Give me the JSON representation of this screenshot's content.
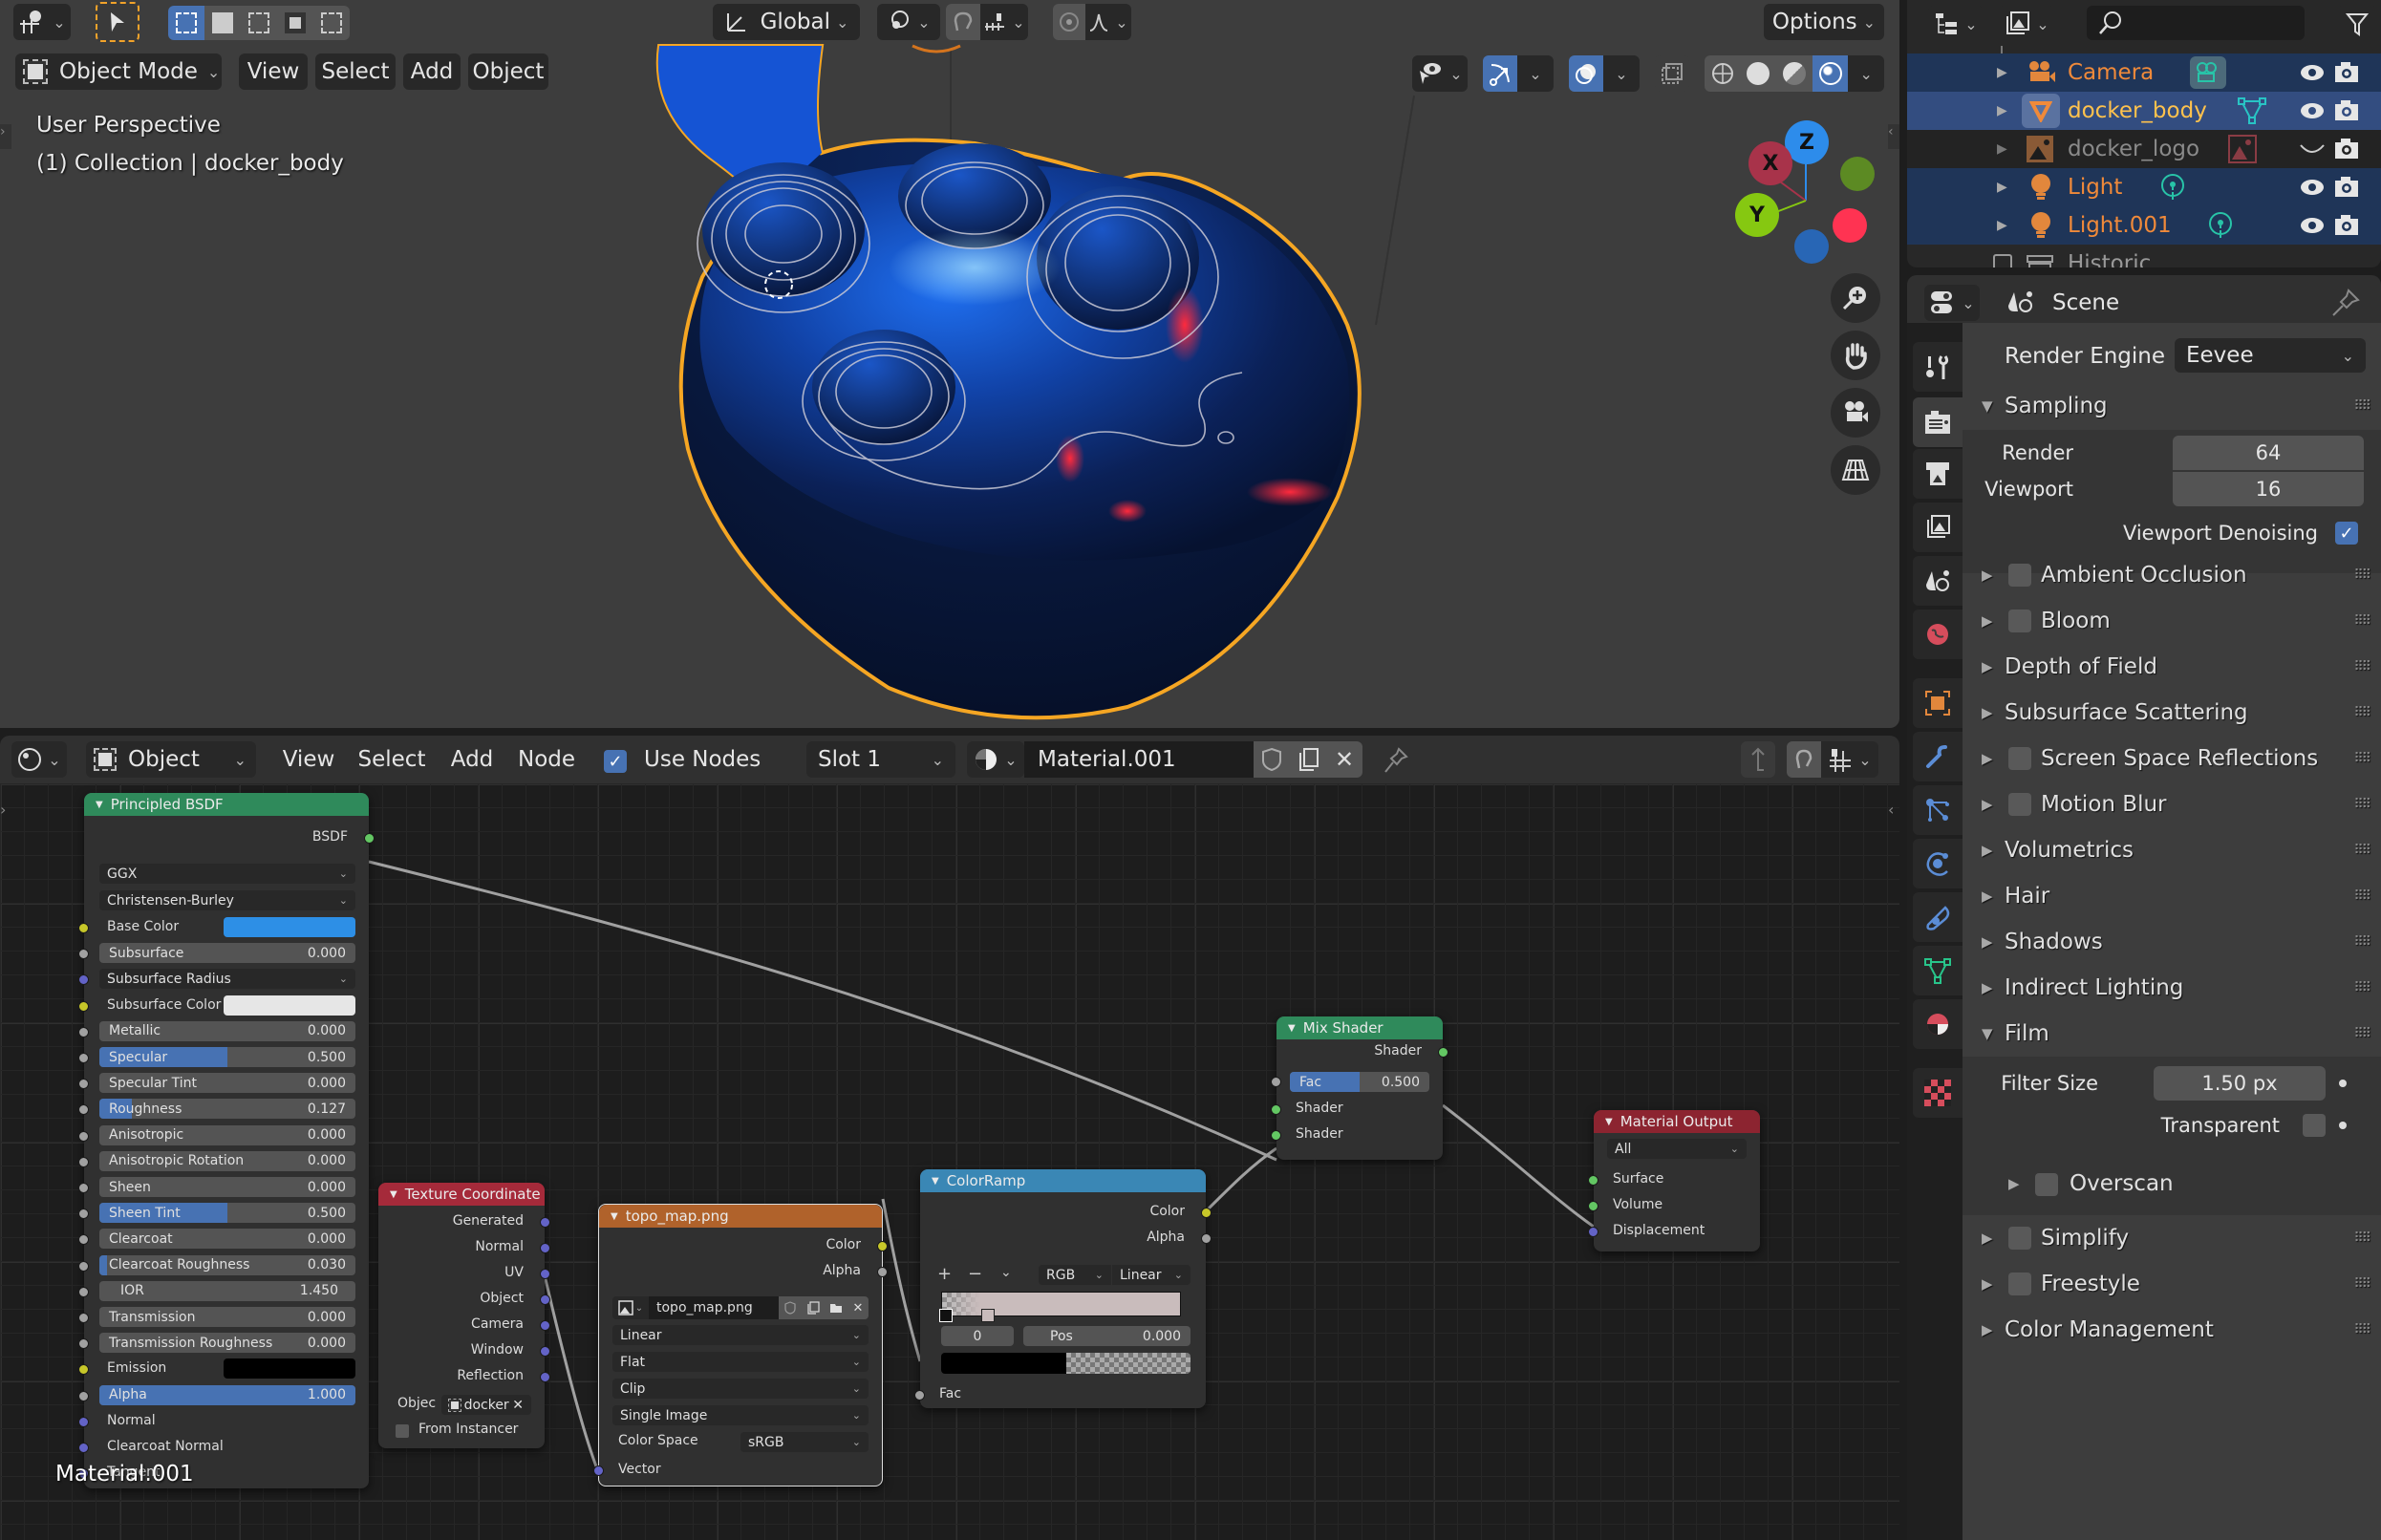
{
  "viewport": {
    "header": {
      "transform_orientation": "Global",
      "options_label": "Options",
      "mode_label": "Object Mode",
      "menus": [
        "View",
        "Select",
        "Add",
        "Object"
      ]
    },
    "overlay": {
      "view_name": "User Perspective",
      "collection_info": "(1) Collection | docker_body"
    },
    "gizmo": {
      "x": "X",
      "y": "Y",
      "z": "Z"
    },
    "colors": {
      "selection_outline": "#f5a623",
      "x_axis": "#a8334a",
      "y_axis": "#86c811",
      "z_axis": "#2d8ceb"
    }
  },
  "outliner": {
    "search_placeholder": "",
    "items": [
      {
        "name": "Camera",
        "type": "camera",
        "state": "partial"
      },
      {
        "name": "docker_body",
        "type": "mesh",
        "state": "active"
      },
      {
        "name": "docker_logo",
        "type": "image",
        "state": "hidden"
      },
      {
        "name": "Light",
        "type": "light",
        "state": "partial"
      },
      {
        "name": "Light.001",
        "type": "light",
        "state": "partial"
      }
    ],
    "partial_item": "Historic"
  },
  "properties": {
    "context_label": "Scene",
    "render_engine_label": "Render Engine",
    "render_engine_value": "Eevee",
    "sampling": {
      "title": "Sampling",
      "render_label": "Render",
      "render_value": "64",
      "viewport_label": "Viewport",
      "viewport_value": "16",
      "denoise_label": "Viewport Denoising",
      "denoise_checked": true
    },
    "panels": [
      {
        "label": "Ambient Occlusion",
        "checkbox": true,
        "checked": false
      },
      {
        "label": "Bloom",
        "checkbox": true,
        "checked": false
      },
      {
        "label": "Depth of Field",
        "checkbox": false
      },
      {
        "label": "Subsurface Scattering",
        "checkbox": false
      },
      {
        "label": "Screen Space Reflections",
        "checkbox": true,
        "checked": false
      },
      {
        "label": "Motion Blur",
        "checkbox": true,
        "checked": false
      },
      {
        "label": "Volumetrics",
        "checkbox": false
      },
      {
        "label": "Hair",
        "checkbox": false
      },
      {
        "label": "Shadows",
        "checkbox": false
      },
      {
        "label": "Indirect Lighting",
        "checkbox": false
      }
    ],
    "film": {
      "title": "Film",
      "filter_size_label": "Filter Size",
      "filter_size_value": "1.50 px",
      "transparent_label": "Transparent",
      "transparent_checked": false,
      "overscan_label": "Overscan"
    },
    "panels_after": [
      {
        "label": "Simplify",
        "checkbox": true,
        "checked": false
      },
      {
        "label": "Freestyle",
        "checkbox": true,
        "checked": false
      },
      {
        "label": "Color Management",
        "checkbox": false
      }
    ]
  },
  "node_editor": {
    "header": {
      "object_label": "Object",
      "menus": [
        "View",
        "Select",
        "Add",
        "Node"
      ],
      "use_nodes_label": "Use Nodes",
      "use_nodes_checked": true,
      "slot_label": "Slot 1",
      "material_name": "Material.001"
    },
    "material_label": "Material.001",
    "principled": {
      "title": "Principled BSDF",
      "output": "BSDF",
      "distribution": "GGX",
      "subsurface_method": "Christensen-Burley",
      "base_color_label": "Base Color",
      "base_color": "#2d8fe6",
      "subsurface_label": "Subsurface",
      "subsurface": "0.000",
      "subsurface_radius_label": "Subsurface Radius",
      "subsurface_color_label": "Subsurface Color",
      "subsurface_color": "#e6e6e6",
      "metallic_label": "Metallic",
      "metallic": "0.000",
      "specular_label": "Specular",
      "specular": "0.500",
      "specular_frac": 0.5,
      "specular_tint_label": "Specular Tint",
      "specular_tint": "0.000",
      "roughness_label": "Roughness",
      "roughness": "0.127",
      "roughness_frac": 0.127,
      "anisotropic_label": "Anisotropic",
      "anisotropic": "0.000",
      "anisotropic_rotation_label": "Anisotropic Rotation",
      "anisotropic_rotation": "0.000",
      "sheen_label": "Sheen",
      "sheen": "0.000",
      "sheen_tint_label": "Sheen Tint",
      "sheen_tint": "0.500",
      "sheen_tint_frac": 0.5,
      "clearcoat_label": "Clearcoat",
      "clearcoat": "0.000",
      "clearcoat_roughness_label": "Clearcoat Roughness",
      "clearcoat_roughness": "0.030",
      "clearcoat_roughness_frac": 0.03,
      "ior_label": "IOR",
      "ior": "1.450",
      "transmission_label": "Transmission",
      "transmission": "0.000",
      "transmission_roughness_label": "Transmission Roughness",
      "transmission_roughness": "0.000",
      "emission_label": "Emission",
      "emission_color": "#000000",
      "alpha_label": "Alpha",
      "alpha": "1.000",
      "alpha_frac": 1.0,
      "normal_label": "Normal",
      "clearcoat_normal_label": "Clearcoat Normal",
      "tangent_label": "Tangent"
    },
    "texcoord": {
      "title": "Texture Coordinate",
      "outputs": [
        "Generated",
        "Normal",
        "UV",
        "Object",
        "Camera",
        "Window",
        "Reflection"
      ],
      "object_label": "Objec",
      "object_value": "docker",
      "from_instancer_label": "From Instancer"
    },
    "image_tex": {
      "title": "topo_map.png",
      "out_color": "Color",
      "out_alpha": "Alpha",
      "image_name": "topo_map.png",
      "interpolation": "Linear",
      "projection": "Flat",
      "extension": "Clip",
      "source": "Single Image",
      "color_space_label": "Color Space",
      "color_space": "sRGB",
      "input_vector": "Vector"
    },
    "colorramp": {
      "title": "ColorRamp",
      "out_color": "Color",
      "out_alpha": "Alpha",
      "color_mode": "RGB",
      "interpolation": "Linear",
      "active_index": "0",
      "pos_label": "Pos",
      "pos_value": "0.000",
      "input_fac": "Fac"
    },
    "mix_shader": {
      "title": "Mix Shader",
      "output": "Shader",
      "fac_label": "Fac",
      "fac": "0.500",
      "fac_frac": 0.5,
      "input1": "Shader",
      "input2": "Shader"
    },
    "material_output": {
      "title": "Material Output",
      "target": "All",
      "inputs": [
        "Surface",
        "Volume",
        "Displacement"
      ]
    },
    "colors": {
      "shader_header": "#2f8a5b",
      "input_header": "#a52a3a",
      "texture_header": "#b0622b",
      "converter_header": "#3a87b5",
      "output_header": "#8c2430"
    }
  }
}
